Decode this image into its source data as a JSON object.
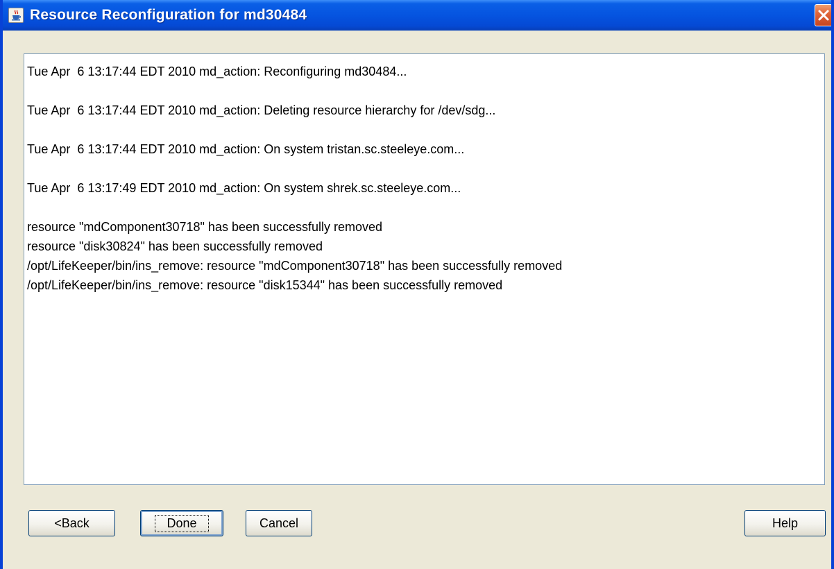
{
  "window": {
    "title": "Resource Reconfiguration for md30484",
    "app_icon": "java-cup-icon",
    "close_icon": "close-icon",
    "colors": {
      "title_bar": "#0554e0",
      "frame": "#0842d6",
      "dialog_bg": "#ece9d8",
      "close_button": "#e0663a"
    }
  },
  "log": {
    "lines": [
      "Tue Apr  6 13:17:44 EDT 2010 md_action: Reconfiguring md30484...",
      "",
      "Tue Apr  6 13:17:44 EDT 2010 md_action: Deleting resource hierarchy for /dev/sdg...",
      "",
      "Tue Apr  6 13:17:44 EDT 2010 md_action: On system tristan.sc.steeleye.com...",
      "",
      "Tue Apr  6 13:17:49 EDT 2010 md_action: On system shrek.sc.steeleye.com...",
      "",
      "resource \"mdComponent30718\" has been successfully removed",
      "resource \"disk30824\" has been successfully removed",
      "/opt/LifeKeeper/bin/ins_remove: resource \"mdComponent30718\" has been successfully removed",
      "/opt/LifeKeeper/bin/ins_remove: resource \"disk15344\" has been successfully removed"
    ]
  },
  "buttons": {
    "back": "<Back",
    "done": "Done",
    "cancel": "Cancel",
    "help": "Help"
  }
}
